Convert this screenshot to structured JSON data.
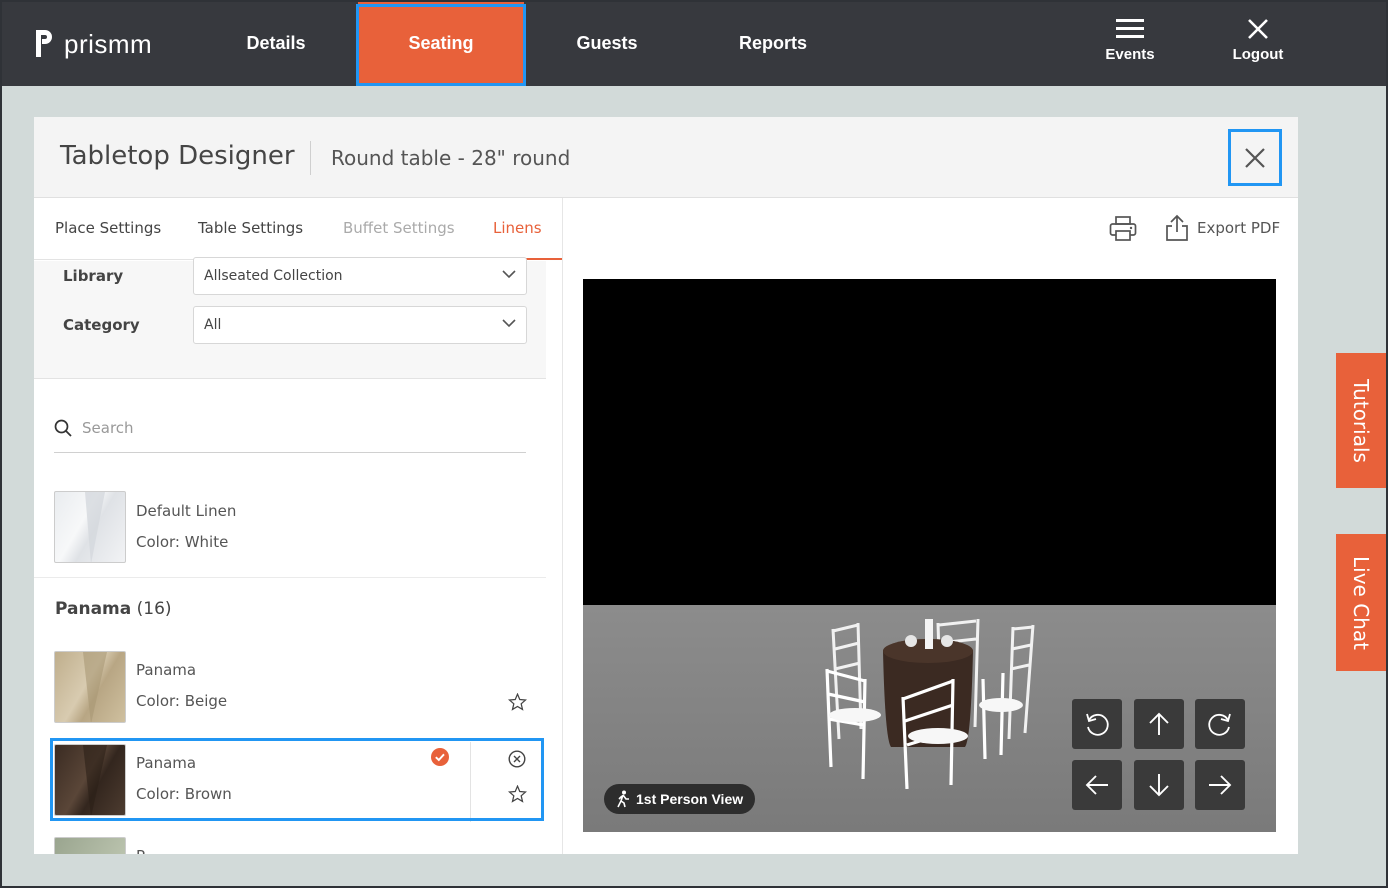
{
  "app": {
    "name": "prismm"
  },
  "nav": {
    "items": [
      {
        "label": "Details",
        "active": false
      },
      {
        "label": "Seating",
        "active": true
      },
      {
        "label": "Guests",
        "active": false
      },
      {
        "label": "Reports",
        "active": false
      }
    ],
    "events_label": "Events",
    "logout_label": "Logout"
  },
  "modal": {
    "title": "Tabletop Designer",
    "subtitle": "Round table - 28\" round"
  },
  "tabs": [
    {
      "label": "Place Settings",
      "state": "normal"
    },
    {
      "label": "Table Settings",
      "state": "normal"
    },
    {
      "label": "Buffet Settings",
      "state": "disabled"
    },
    {
      "label": "Linens",
      "state": "active"
    }
  ],
  "filters": {
    "library_label": "Library",
    "library_value": "Allseated Collection",
    "category_label": "Category",
    "category_value": "All"
  },
  "search": {
    "placeholder": "Search"
  },
  "default_item": {
    "name": "Default Linen",
    "color": "Color: White"
  },
  "group": {
    "name": "Panama",
    "count": "(16)"
  },
  "items": [
    {
      "name": "Panama",
      "color": "Color: Beige",
      "selected": false
    },
    {
      "name": "Panama",
      "color": "Color: Brown",
      "selected": true
    },
    {
      "name": "P",
      "color": "",
      "selected": false
    }
  ],
  "toolbar": {
    "export_label": "Export PDF"
  },
  "viewer": {
    "first_person_label": "1st Person View"
  },
  "side_tabs": {
    "tutorials": "Tutorials",
    "live_chat": "Live Chat"
  },
  "colors": {
    "accent": "#e8613a",
    "highlight": "#2196f3",
    "topbar": "#37393e"
  }
}
